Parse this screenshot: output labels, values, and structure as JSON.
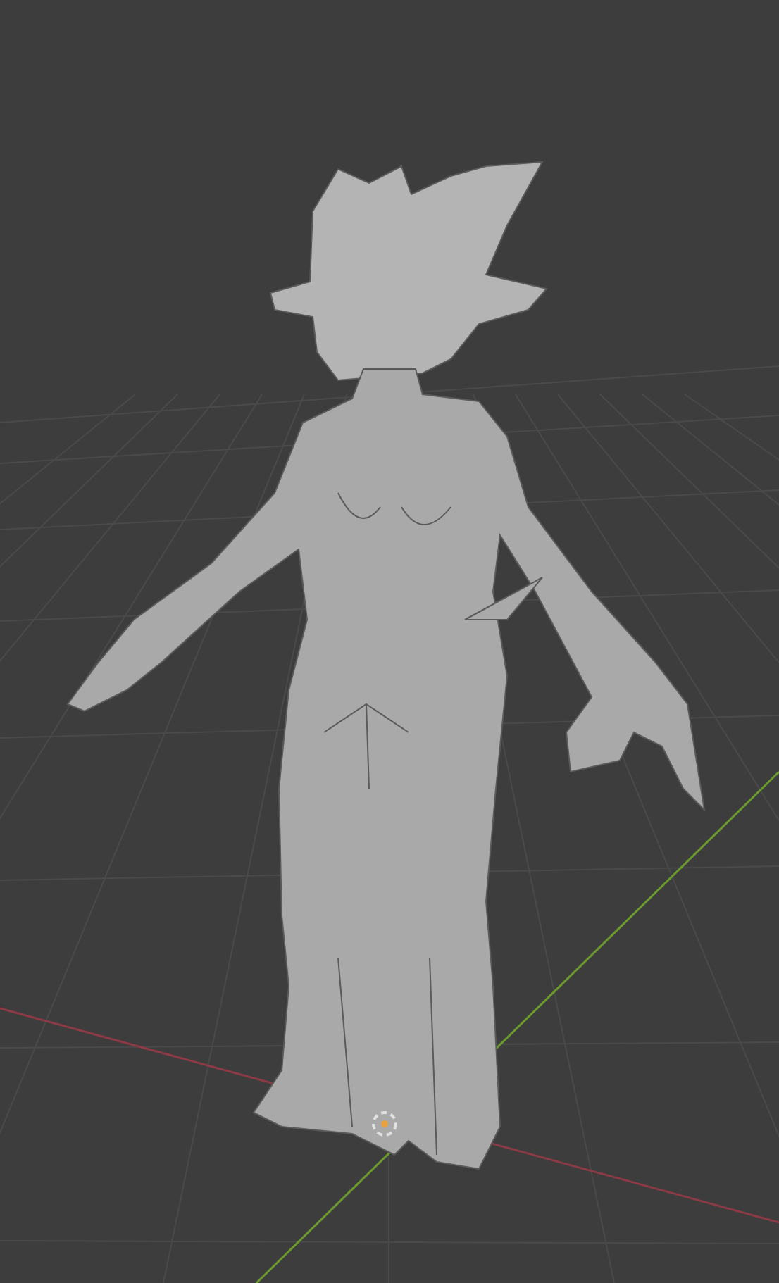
{
  "viewport": {
    "show_floor_grid": true,
    "show_axes": true,
    "show_3d_cursor": true
  }
}
